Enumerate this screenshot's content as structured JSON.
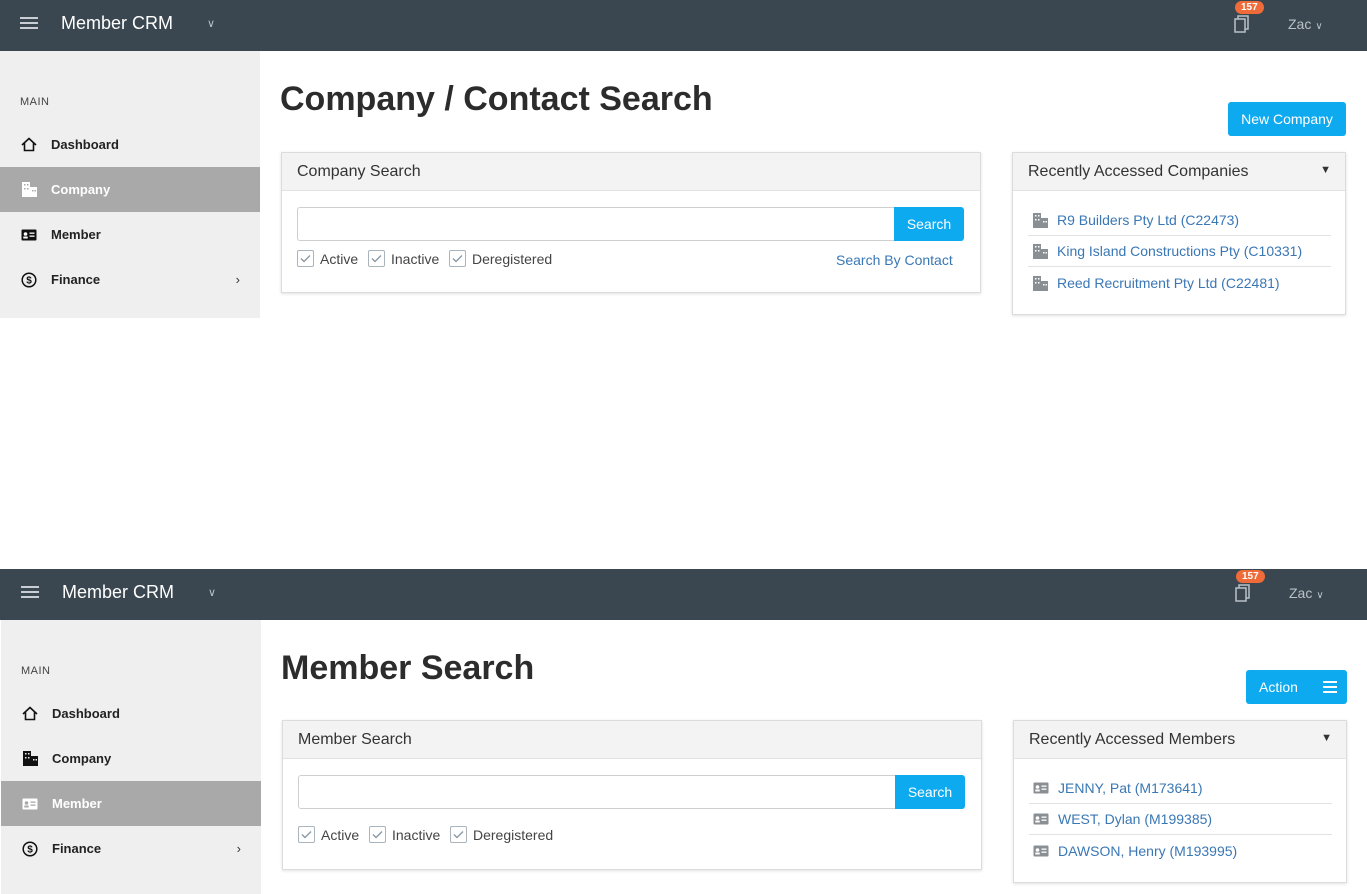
{
  "screens": [
    {
      "app_title": "Member CRM",
      "notification_count": "157",
      "user_name": "Zac",
      "sidebar": {
        "section": "MAIN",
        "items": [
          {
            "label": "Dashboard",
            "icon": "home-icon"
          },
          {
            "label": "Company",
            "icon": "building-icon",
            "active": true
          },
          {
            "label": "Member",
            "icon": "id-card-icon"
          },
          {
            "label": "Finance",
            "icon": "dollar-icon"
          }
        ]
      },
      "page_title": "Company / Contact Search",
      "action_button": "New Company",
      "search_panel": {
        "title": "Company Search",
        "input_value": "",
        "search_button": "Search",
        "checkboxes": [
          "Active",
          "Inactive",
          "Deregistered"
        ],
        "link": "Search By Contact"
      },
      "recent_panel": {
        "title": "Recently Accessed Companies",
        "items": [
          "R9 Builders Pty Ltd (C22473)",
          "King Island Constructions Pty (C10331)",
          "Reed Recruitment Pty Ltd (C22481)"
        ]
      }
    },
    {
      "app_title": "Member CRM",
      "notification_count": "157",
      "user_name": "Zac",
      "sidebar": {
        "section": "MAIN",
        "items": [
          {
            "label": "Dashboard",
            "icon": "home-icon"
          },
          {
            "label": "Company",
            "icon": "building-icon"
          },
          {
            "label": "Member",
            "icon": "id-card-icon",
            "active": true
          },
          {
            "label": "Finance",
            "icon": "dollar-icon"
          }
        ]
      },
      "page_title": "Member Search",
      "action_button": "Action",
      "search_panel": {
        "title": "Member Search",
        "input_value": "",
        "search_button": "Search",
        "checkboxes": [
          "Active",
          "Inactive",
          "Deregistered"
        ]
      },
      "recent_panel": {
        "title": "Recently Accessed Members",
        "items": [
          "JENNY, Pat (M173641)",
          "WEST, Dylan (M199385)",
          "DAWSON, Henry (M193995)"
        ]
      }
    }
  ],
  "colors": {
    "topbar": "#3a4750",
    "primary": "#0eaaf0",
    "badge": "#ef6c3a",
    "link": "#3a77b5",
    "sidebar_active": "#a9a9a9"
  }
}
